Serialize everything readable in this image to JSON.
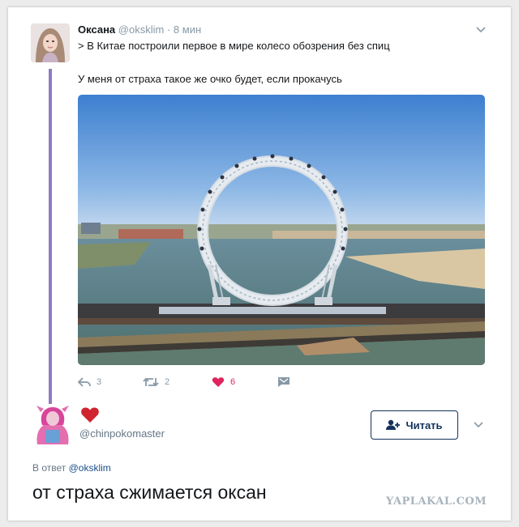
{
  "tweet": {
    "author_name": "Оксана",
    "author_handle": "@oksklim",
    "separator": "·",
    "time": "8 мин",
    "line1": "> В Китае построили первое в мире колесо обозрения без спиц",
    "line2": "У меня от страха такое же очко будет, если прокачусь",
    "photo_icon": "ferris-wheel-photo",
    "actions": {
      "reply_count": "3",
      "retweet_count": "2",
      "like_count": "6"
    }
  },
  "reply": {
    "handle": "@chinpokomaster",
    "follow_label": "Читать",
    "reply_prefix": "В ответ",
    "reply_mention": "@oksklim",
    "text": "от страха сжимается оксан"
  },
  "watermark": "YAPLAKAL.COM",
  "colors": {
    "thread_line": "#8e7cc3",
    "like_red": "#e0245e",
    "follow_border": "#14325c",
    "muted": "#8899a6"
  }
}
